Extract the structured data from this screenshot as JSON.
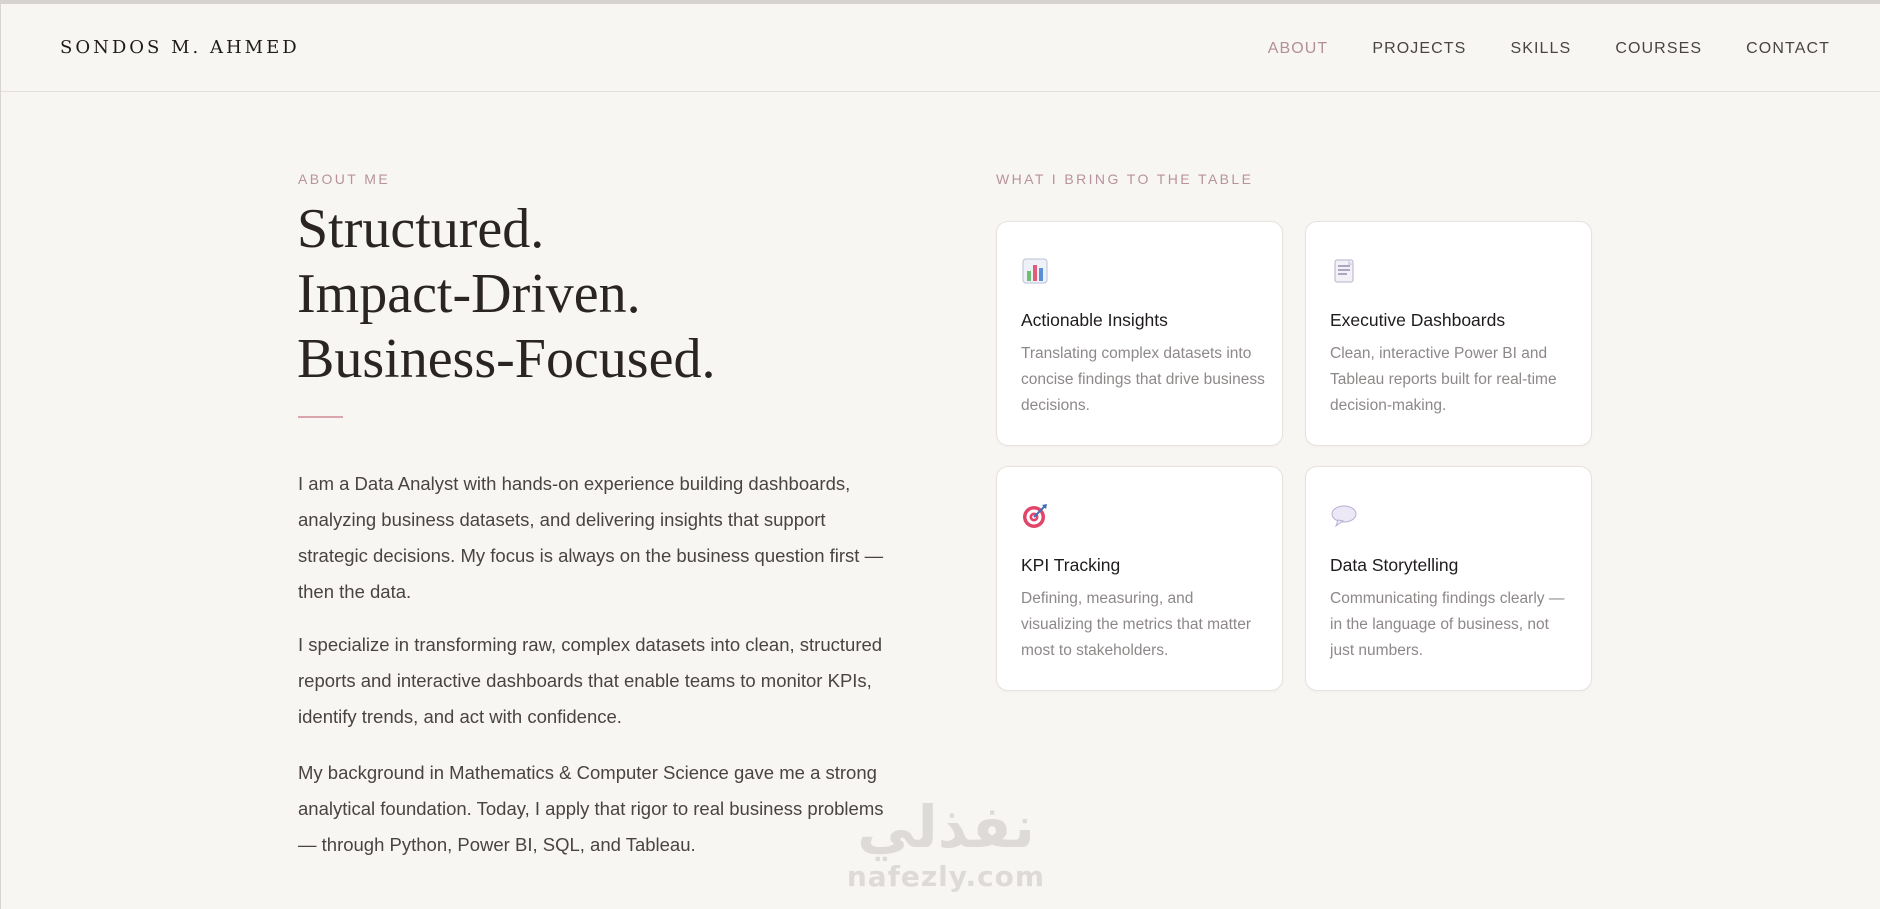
{
  "header": {
    "brand": "SONDOS M. AHMED",
    "nav": [
      "ABOUT",
      "PROJECTS",
      "SKILLS",
      "COURSES",
      "CONTACT"
    ],
    "active_nav": "ABOUT"
  },
  "about": {
    "eyebrow": "ABOUT ME",
    "headline": [
      "Structured.",
      "Impact-Driven.",
      "Business-Focused."
    ],
    "paragraphs": [
      "I am a Data Analyst with hands-on experience building dashboards, analyzing business datasets, and delivering insights that support strategic decisions. My focus is always on the business question first — then the data.",
      "I specialize in transforming raw, complex datasets into clean, structured reports and interactive dashboards that enable teams to monitor KPIs, identify trends, and act with confidence.",
      "My background in Mathematics & Computer Science gave me a strong analytical foundation. Today, I apply that rigor to real business problems — through Python, Power BI, SQL, and Tableau."
    ]
  },
  "bring": {
    "eyebrow": "WHAT I BRING TO THE TABLE",
    "cards": [
      {
        "icon": "bar-chart-icon",
        "title": "Actionable Insights",
        "desc": "Translating complex datasets into concise findings that drive business decisions."
      },
      {
        "icon": "report-icon",
        "title": "Executive Dashboards",
        "desc": "Clean, interactive Power BI and Tableau reports built for real-time decision-making."
      },
      {
        "icon": "target-icon",
        "title": "KPI Tracking",
        "desc": "Defining, measuring, and visualizing the metrics that matter most to stakeholders."
      },
      {
        "icon": "speech-bubble-icon",
        "title": "Data Storytelling",
        "desc": "Communicating findings clearly — in the language of business, not just numbers."
      }
    ]
  },
  "watermark": {
    "arabic": "نفذلي",
    "latin": "nafezly.com"
  },
  "colors": {
    "background": "#f8f6f3",
    "accent": "#b8929e",
    "rule": "#d8a6ac"
  }
}
